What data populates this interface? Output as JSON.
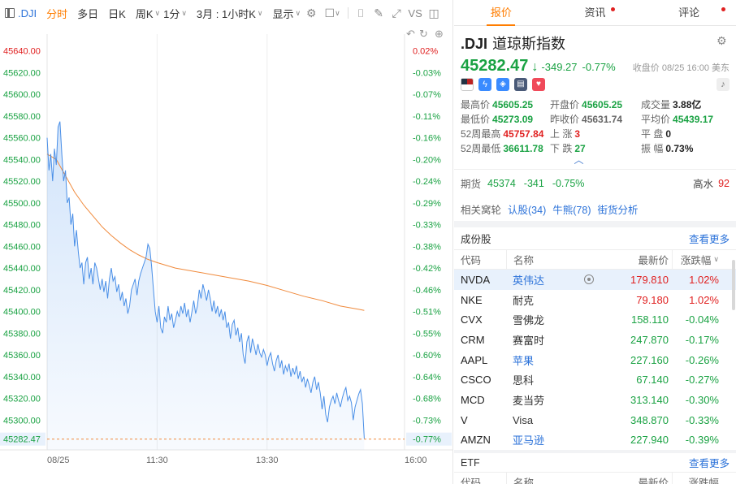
{
  "toolbar": {
    "symbol": ".DJI",
    "tabs": [
      "分时",
      "多日",
      "日K"
    ],
    "active_tab": "分时",
    "dropdowns": [
      "周K",
      "1分",
      "3月 : 1小时K",
      "显示"
    ],
    "vs_label": "VS"
  },
  "chart_data": {
    "type": "line",
    "prev_close": 45631.74,
    "current": 45282.47,
    "current_label": "45282.47",
    "current_pct_label": "-0.77%",
    "y_ticks": [
      "45640.00",
      "45620.00",
      "45600.00",
      "45580.00",
      "45560.00",
      "45540.00",
      "45520.00",
      "45500.00",
      "45480.00",
      "45460.00",
      "45440.00",
      "45420.00",
      "45400.00",
      "45380.00",
      "45360.00",
      "45340.00",
      "45320.00",
      "45300.00"
    ],
    "pct_ticks": [
      "0.02%",
      "-0.03%",
      "-0.07%",
      "-0.11%",
      "-0.16%",
      "-0.20%",
      "-0.24%",
      "-0.29%",
      "-0.33%",
      "-0.38%",
      "-0.42%",
      "-0.46%",
      "-0.51%",
      "-0.55%",
      "-0.60%",
      "-0.64%",
      "-0.68%",
      "-0.73%"
    ],
    "ylim": [
      45280,
      45645
    ],
    "x_labels": [
      "08/25",
      "11:30",
      "13:30",
      "16:00"
    ],
    "x_label_minutes": [
      0,
      120,
      240,
      390
    ],
    "x_range_minutes": [
      0,
      390
    ],
    "series": [
      {
        "name": "price",
        "color": "#4a8fe7",
        "points": [
          [
            0,
            45560
          ],
          [
            2,
            45530
          ],
          [
            4,
            45545
          ],
          [
            6,
            45520
          ],
          [
            8,
            45550
          ],
          [
            10,
            45535
          ],
          [
            12,
            45570
          ],
          [
            14,
            45575
          ],
          [
            16,
            45545
          ],
          [
            18,
            45520
          ],
          [
            20,
            45530
          ],
          [
            22,
            45500
          ],
          [
            24,
            45505
          ],
          [
            26,
            45480
          ],
          [
            28,
            45490
          ],
          [
            30,
            45460
          ],
          [
            32,
            45475
          ],
          [
            34,
            45455
          ],
          [
            36,
            45440
          ],
          [
            38,
            45445
          ],
          [
            40,
            45425
          ],
          [
            42,
            45445
          ],
          [
            44,
            45450
          ],
          [
            46,
            45430
          ],
          [
            48,
            45440
          ],
          [
            50,
            45425
          ],
          [
            52,
            45445
          ],
          [
            54,
            45440
          ],
          [
            56,
            45430
          ],
          [
            58,
            45420
          ],
          [
            60,
            45430
          ],
          [
            62,
            45418
          ],
          [
            64,
            45428
          ],
          [
            66,
            45412
          ],
          [
            68,
            45430
          ],
          [
            70,
            45440
          ],
          [
            72,
            45428
          ],
          [
            74,
            45432
          ],
          [
            76,
            45418
          ],
          [
            78,
            45425
          ],
          [
            80,
            45410
          ],
          [
            82,
            45418
          ],
          [
            84,
            45405
          ],
          [
            86,
            45412
          ],
          [
            88,
            45398
          ],
          [
            90,
            45405
          ],
          [
            92,
            45420
          ],
          [
            94,
            45425
          ],
          [
            96,
            45430
          ],
          [
            98,
            45415
          ],
          [
            100,
            45428
          ],
          [
            102,
            45435
          ],
          [
            104,
            45440
          ],
          [
            106,
            45445
          ],
          [
            108,
            45450
          ],
          [
            110,
            45462
          ],
          [
            112,
            45458
          ],
          [
            114,
            45442
          ],
          [
            116,
            45420
          ],
          [
            118,
            45400
          ],
          [
            120,
            45390
          ],
          [
            122,
            45405
          ],
          [
            124,
            45385
          ],
          [
            126,
            45380
          ],
          [
            128,
            45395
          ],
          [
            130,
            45390
          ],
          [
            132,
            45405
          ],
          [
            134,
            45392
          ],
          [
            136,
            45398
          ],
          [
            138,
            45385
          ],
          [
            140,
            45392
          ],
          [
            142,
            45400
          ],
          [
            144,
            45395
          ],
          [
            146,
            45405
          ],
          [
            148,
            45398
          ],
          [
            150,
            45408
          ],
          [
            152,
            45395
          ],
          [
            154,
            45402
          ],
          [
            156,
            45390
          ],
          [
            158,
            45400
          ],
          [
            160,
            45410
          ],
          [
            162,
            45398
          ],
          [
            164,
            45405
          ],
          [
            166,
            45420
          ],
          [
            168,
            45412
          ],
          [
            170,
            45425
          ],
          [
            172,
            45418
          ],
          [
            174,
            45410
          ],
          [
            176,
            45420
          ],
          [
            178,
            45412
          ],
          [
            180,
            45400
          ],
          [
            182,
            45410
          ],
          [
            184,
            45398
          ],
          [
            186,
            45405
          ],
          [
            188,
            45395
          ],
          [
            190,
            45402
          ],
          [
            192,
            45392
          ],
          [
            194,
            45400
          ],
          [
            196,
            45385
          ],
          [
            198,
            45390
          ],
          [
            200,
            45375
          ],
          [
            202,
            45388
          ],
          [
            204,
            45392
          ],
          [
            206,
            45378
          ],
          [
            208,
            45385
          ],
          [
            210,
            45372
          ],
          [
            212,
            45380
          ],
          [
            214,
            45360
          ],
          [
            216,
            45352
          ],
          [
            218,
            45372
          ],
          [
            220,
            45378
          ],
          [
            222,
            45362
          ],
          [
            224,
            45375
          ],
          [
            226,
            45368
          ],
          [
            228,
            45360
          ],
          [
            230,
            45370
          ],
          [
            232,
            45362
          ],
          [
            234,
            45358
          ],
          [
            236,
            45365
          ],
          [
            238,
            45360
          ],
          [
            240,
            45350
          ],
          [
            242,
            45358
          ],
          [
            244,
            45362
          ],
          [
            246,
            45352
          ],
          [
            248,
            45345
          ],
          [
            250,
            45355
          ],
          [
            252,
            45360
          ],
          [
            254,
            45348
          ],
          [
            256,
            45355
          ],
          [
            258,
            45342
          ],
          [
            260,
            45350
          ],
          [
            262,
            45345
          ],
          [
            264,
            45352
          ],
          [
            266,
            45340
          ],
          [
            268,
            45348
          ],
          [
            270,
            45342
          ],
          [
            272,
            45350
          ],
          [
            274,
            45338
          ],
          [
            276,
            45345
          ],
          [
            278,
            45335
          ],
          [
            280,
            45340
          ],
          [
            282,
            45330
          ],
          [
            284,
            45338
          ],
          [
            286,
            45332
          ],
          [
            288,
            45325
          ],
          [
            290,
            45335
          ],
          [
            292,
            45340
          ],
          [
            294,
            45328
          ],
          [
            296,
            45335
          ],
          [
            298,
            45325
          ],
          [
            300,
            45310
          ],
          [
            302,
            45322
          ],
          [
            304,
            45305
          ],
          [
            306,
            45298
          ],
          [
            308,
            45312
          ],
          [
            310,
            45318
          ],
          [
            312,
            45322
          ],
          [
            314,
            45315
          ],
          [
            316,
            45325
          ],
          [
            318,
            45318
          ],
          [
            320,
            45312
          ],
          [
            322,
            45320
          ],
          [
            324,
            45326
          ],
          [
            326,
            45330
          ],
          [
            328,
            45318
          ],
          [
            330,
            45322
          ],
          [
            332,
            45316
          ],
          [
            334,
            45300
          ],
          [
            336,
            45312
          ],
          [
            338,
            45318
          ],
          [
            340,
            45324
          ],
          [
            342,
            45328
          ],
          [
            344,
            45315
          ],
          [
            346,
            45283
          ]
        ]
      },
      {
        "name": "avg",
        "color": "#f08a3c",
        "points": [
          [
            0,
            45545
          ],
          [
            10,
            45540
          ],
          [
            20,
            45525
          ],
          [
            30,
            45510
          ],
          [
            40,
            45498
          ],
          [
            50,
            45488
          ],
          [
            60,
            45478
          ],
          [
            70,
            45470
          ],
          [
            80,
            45463
          ],
          [
            90,
            45457
          ],
          [
            100,
            45452
          ],
          [
            110,
            45448
          ],
          [
            120,
            45445
          ],
          [
            140,
            45440
          ],
          [
            160,
            45437
          ],
          [
            180,
            45434
          ],
          [
            200,
            45431
          ],
          [
            220,
            45428
          ],
          [
            240,
            45424
          ],
          [
            260,
            45419
          ],
          [
            280,
            45414
          ],
          [
            300,
            45410
          ],
          [
            320,
            45405
          ],
          [
            340,
            45402
          ],
          [
            346,
            45401
          ]
        ]
      }
    ]
  },
  "tabs": [
    {
      "label": "报价",
      "dot": false
    },
    {
      "label": "资讯",
      "dot": true
    },
    {
      "label": "评论",
      "dot": true
    }
  ],
  "quote": {
    "symbol": ".DJI",
    "name": "道琼斯指数",
    "price": "45282.47",
    "change": "-349.27",
    "change_pct": "-0.77%",
    "close_time": "收盘价 08/25 16:00 美东"
  },
  "stats": [
    [
      {
        "label": "最高价",
        "value": "45605.25",
        "color": "down"
      },
      {
        "label": "开盘价",
        "value": "45605.25",
        "color": "down"
      },
      {
        "label": "成交量",
        "value": "3.88亿",
        "color": ""
      }
    ],
    [
      {
        "label": "最低价",
        "value": "45273.09",
        "color": "down"
      },
      {
        "label": "昨收价",
        "value": "45631.74",
        "color": "plain"
      },
      {
        "label": "平均价",
        "value": "45439.17",
        "color": "down"
      }
    ],
    [
      {
        "label": "52周最高",
        "value": "45757.84",
        "color": "up"
      },
      {
        "label": "上 涨",
        "value": "3",
        "color": "up"
      },
      {
        "label": "平 盘",
        "value": "0",
        "color": ""
      }
    ],
    [
      {
        "label": "52周最低",
        "value": "36611.78",
        "color": "down"
      },
      {
        "label": "下 跌",
        "value": "27",
        "color": "down"
      },
      {
        "label": "振 幅",
        "value": "0.73%",
        "color": ""
      }
    ]
  ],
  "futures": {
    "label": "期货",
    "price": "45374",
    "change": "-341",
    "pct": "-0.75%",
    "gs_label": "高水",
    "gs_value": "92"
  },
  "links": {
    "label": "相关窝轮",
    "items": [
      "认股(34)",
      "牛熊(78)",
      "街货分析"
    ]
  },
  "constituents": {
    "title": "成份股",
    "more": "查看更多",
    "headers": {
      "code": "代码",
      "name": "名称",
      "last": "最新价",
      "chg": "涨跌幅"
    },
    "rows": [
      {
        "code": "NVDA",
        "name": "英伟达",
        "last": "179.810",
        "chg": "1.02%",
        "dir": "up",
        "blue": true,
        "sel": true
      },
      {
        "code": "NKE",
        "name": "耐克",
        "last": "79.180",
        "chg": "1.02%",
        "dir": "up",
        "blue": false,
        "sel": false
      },
      {
        "code": "CVX",
        "name": "雪佛龙",
        "last": "158.110",
        "chg": "-0.04%",
        "dir": "down",
        "blue": false,
        "sel": false
      },
      {
        "code": "CRM",
        "name": "赛富时",
        "last": "247.870",
        "chg": "-0.17%",
        "dir": "down",
        "blue": false,
        "sel": false
      },
      {
        "code": "AAPL",
        "name": "苹果",
        "last": "227.160",
        "chg": "-0.26%",
        "dir": "down",
        "blue": true,
        "sel": false
      },
      {
        "code": "CSCO",
        "name": "思科",
        "last": "67.140",
        "chg": "-0.27%",
        "dir": "down",
        "blue": false,
        "sel": false
      },
      {
        "code": "MCD",
        "name": "麦当劳",
        "last": "313.140",
        "chg": "-0.30%",
        "dir": "down",
        "blue": false,
        "sel": false
      },
      {
        "code": "V",
        "name": "Visa",
        "last": "348.870",
        "chg": "-0.33%",
        "dir": "down",
        "blue": false,
        "sel": false
      },
      {
        "code": "AMZN",
        "name": "亚马逊",
        "last": "227.940",
        "chg": "-0.39%",
        "dir": "down",
        "blue": true,
        "sel": false
      }
    ]
  },
  "etf": {
    "title": "ETF",
    "more": "查看更多",
    "headers": {
      "code": "代码",
      "name": "名称",
      "last": "最新价",
      "chg": "涨跌幅"
    }
  },
  "colors": {
    "accent": "#ff7d00",
    "up": "#e02020",
    "down": "#1aa243",
    "link": "#2b72d9"
  }
}
